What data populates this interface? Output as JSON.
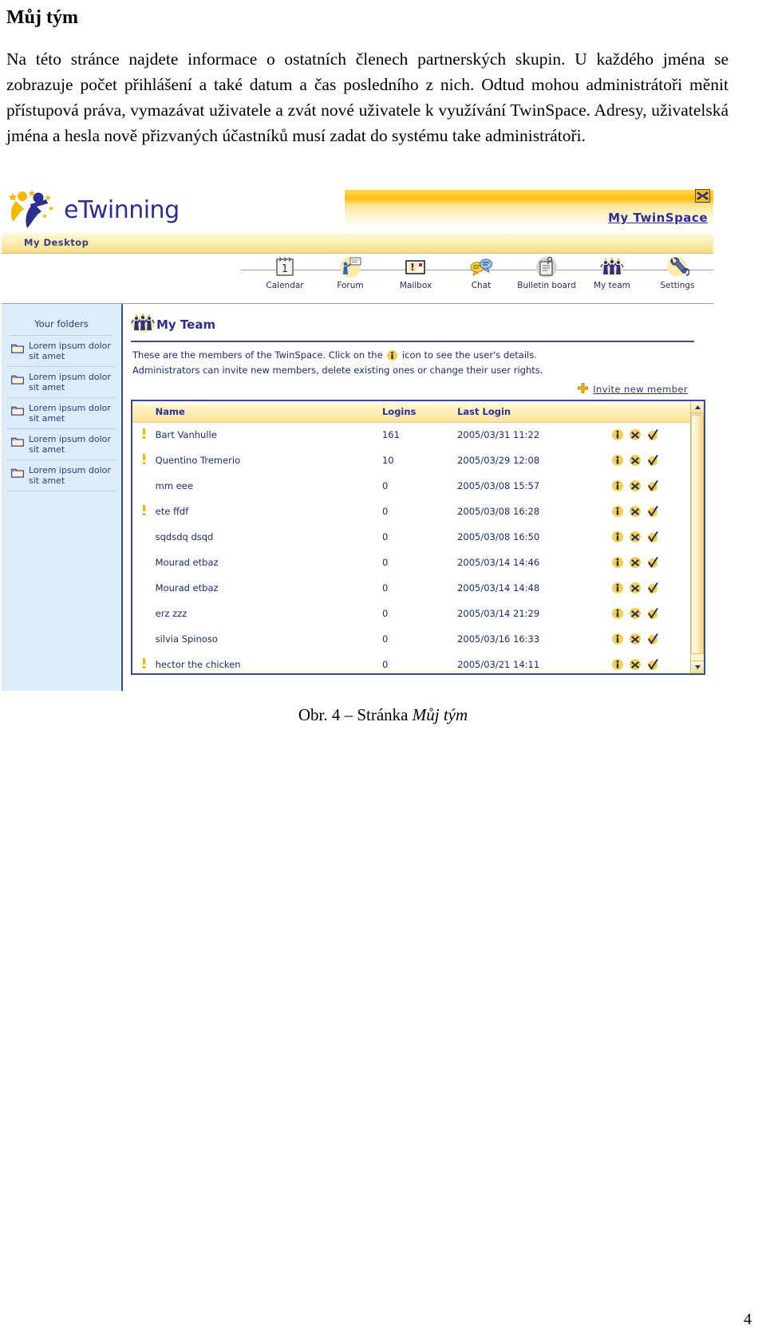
{
  "document": {
    "heading": "Můj tým",
    "paragraph": "Na této stránce najdete informace o ostatních členech partnerských skupin. U každého jména se zobrazuje počet  přihlášení a také datum a čas posledního z nich. Odtud mohou administrátoři měnit přístupová práva, vymazávat uživatele a zvát nové uživatele k využívání TwinSpace. Adresy, uživatelská jména a hesla nově přizvaných účastníků musí zadat do systému take administrátoři.",
    "caption_prefix": "Obr. 4 –  Stránka ",
    "caption_italic": "Můj tým",
    "page_number": "4"
  },
  "screenshot": {
    "brand": {
      "logo_text": "eTwinning",
      "logo_icon": "etwinning-figures-icon"
    },
    "header": {
      "twinspace_link": "My TwinSpace",
      "close_icon": "close-icon",
      "my_desktop": "My Desktop"
    },
    "nav": [
      {
        "label": "Calendar",
        "icon": "calendar-icon"
      },
      {
        "label": "Forum",
        "icon": "forum-icon"
      },
      {
        "label": "Mailbox",
        "icon": "mailbox-icon"
      },
      {
        "label": "Chat",
        "icon": "chat-icon"
      },
      {
        "label": "Bulletin board",
        "icon": "bulletin-board-icon"
      },
      {
        "label": "My team",
        "icon": "my-team-icon"
      },
      {
        "label": "Settings",
        "icon": "settings-wrench-icon"
      }
    ],
    "sidebar": {
      "heading": "Your folders",
      "folders": [
        "Lorem ipsum dolor sit amet",
        "Lorem ipsum dolor sit amet",
        "Lorem ipsum dolor sit amet",
        "Lorem ipsum dolor sit amet",
        "Lorem ipsum dolor sit amet"
      ]
    },
    "main": {
      "title": "My Team",
      "title_icon": "my-team-icon",
      "description_line1_a": "These are the members of the TwinSpace. Click on the",
      "description_line1_b": "icon to see the user's details.",
      "description_line2": "Administrators can invite new members, delete existing ones or change their user rights.",
      "invite_label": "Invite new member",
      "invite_icon": "plus-icon",
      "columns": [
        "",
        "Name",
        "Logins",
        "Last Login",
        ""
      ],
      "row_actions": {
        "info": "info-icon",
        "delete": "delete-x-icon",
        "approve": "approve-check-icon"
      },
      "rows": [
        {
          "admin": true,
          "name": "Bart Vanhulle",
          "logins": "161",
          "last_login": "2005/03/31 11:22"
        },
        {
          "admin": true,
          "name": "Quentino Tremerio",
          "logins": "10",
          "last_login": "2005/03/29 12:08"
        },
        {
          "admin": false,
          "name": "mm eee",
          "logins": "0",
          "last_login": "2005/03/08 15:57"
        },
        {
          "admin": true,
          "name": "ete ffdf",
          "logins": "0",
          "last_login": "2005/03/08 16:28"
        },
        {
          "admin": false,
          "name": "sqdsdq dsqd",
          "logins": "0",
          "last_login": "2005/03/08 16:50"
        },
        {
          "admin": false,
          "name": "Mourad etbaz",
          "logins": "0",
          "last_login": "2005/03/14 14:46"
        },
        {
          "admin": false,
          "name": "Mourad etbaz",
          "logins": "0",
          "last_login": "2005/03/14 14:48"
        },
        {
          "admin": false,
          "name": "erz zzz",
          "logins": "0",
          "last_login": "2005/03/14 21:29"
        },
        {
          "admin": false,
          "name": "silvia Spinoso",
          "logins": "0",
          "last_login": "2005/03/16 16:33"
        },
        {
          "admin": true,
          "name": "hector the chicken",
          "logins": "0",
          "last_login": "2005/03/21 14:11"
        }
      ]
    },
    "colors": {
      "brand_blue": "#2b2f8f",
      "brand_yellow": "#fbbe12",
      "sidebar_bg": "#dcecf8",
      "border_blue": "#3b4a8c"
    }
  }
}
